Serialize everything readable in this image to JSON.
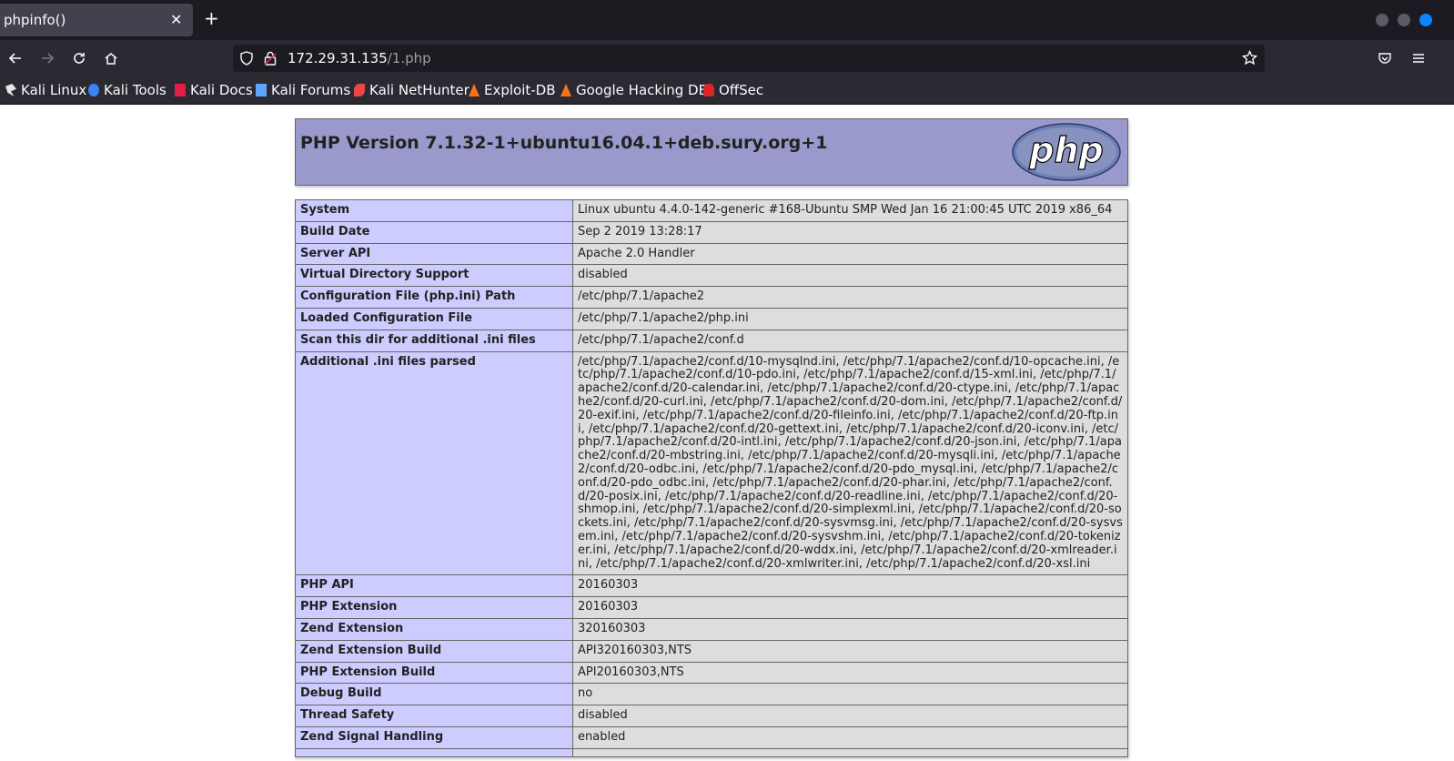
{
  "tab": {
    "title": "phpinfo()"
  },
  "nav": {
    "url_host": "172.29.31.135",
    "url_path": "/1.php"
  },
  "bookmarks": [
    {
      "label": "Kali Linux",
      "icon": "kali-dragon-icon",
      "color": "#e6e6e6"
    },
    {
      "label": "Kali Tools",
      "icon": "kali-tools-icon",
      "color": "#3b82f6"
    },
    {
      "label": "Kali Docs",
      "icon": "kali-docs-icon",
      "color": "#e11d48"
    },
    {
      "label": "Kali Forums",
      "icon": "kali-forums-icon",
      "color": "#60a5fa"
    },
    {
      "label": "Kali NetHunter",
      "icon": "nethunter-icon",
      "color": "#ef4444"
    },
    {
      "label": "Exploit-DB",
      "icon": "exploit-db-icon",
      "color": "#f97316"
    },
    {
      "label": "Google Hacking DB",
      "icon": "ghdb-icon",
      "color": "#f97316"
    },
    {
      "label": "OffSec",
      "icon": "offsec-icon",
      "color": "#dc2626"
    }
  ],
  "page": {
    "title": "PHP Version 7.1.32-1+ubuntu16.04.1+deb.sury.org+1",
    "logo_text": "php",
    "rows": [
      {
        "key": "System",
        "value": "Linux ubuntu 4.4.0-142-generic #168-Ubuntu SMP Wed Jan 16 21:00:45 UTC 2019 x86_64"
      },
      {
        "key": "Build Date",
        "value": "Sep 2 2019 13:28:17"
      },
      {
        "key": "Server API",
        "value": "Apache 2.0 Handler"
      },
      {
        "key": "Virtual Directory Support",
        "value": "disabled"
      },
      {
        "key": "Configuration File (php.ini) Path",
        "value": "/etc/php/7.1/apache2"
      },
      {
        "key": "Loaded Configuration File",
        "value": "/etc/php/7.1/apache2/php.ini"
      },
      {
        "key": "Scan this dir for additional .ini files",
        "value": "/etc/php/7.1/apache2/conf.d"
      },
      {
        "key": "Additional .ini files parsed",
        "value": "/etc/php/7.1/apache2/conf.d/10-mysqlnd.ini, /etc/php/7.1/apache2/conf.d/10-opcache.ini, /etc/php/7.1/apache2/conf.d/10-pdo.ini, /etc/php/7.1/apache2/conf.d/15-xml.ini, /etc/php/7.1/apache2/conf.d/20-calendar.ini, /etc/php/7.1/apache2/conf.d/20-ctype.ini, /etc/php/7.1/apache2/conf.d/20-curl.ini, /etc/php/7.1/apache2/conf.d/20-dom.ini, /etc/php/7.1/apache2/conf.d/20-exif.ini, /etc/php/7.1/apache2/conf.d/20-fileinfo.ini, /etc/php/7.1/apache2/conf.d/20-ftp.ini, /etc/php/7.1/apache2/conf.d/20-gettext.ini, /etc/php/7.1/apache2/conf.d/20-iconv.ini, /etc/php/7.1/apache2/conf.d/20-intl.ini, /etc/php/7.1/apache2/conf.d/20-json.ini, /etc/php/7.1/apache2/conf.d/20-mbstring.ini, /etc/php/7.1/apache2/conf.d/20-mysqli.ini, /etc/php/7.1/apache2/conf.d/20-odbc.ini, /etc/php/7.1/apache2/conf.d/20-pdo_mysql.ini, /etc/php/7.1/apache2/conf.d/20-pdo_odbc.ini, /etc/php/7.1/apache2/conf.d/20-phar.ini, /etc/php/7.1/apache2/conf.d/20-posix.ini, /etc/php/7.1/apache2/conf.d/20-readline.ini, /etc/php/7.1/apache2/conf.d/20-shmop.ini, /etc/php/7.1/apache2/conf.d/20-simplexml.ini, /etc/php/7.1/apache2/conf.d/20-sockets.ini, /etc/php/7.1/apache2/conf.d/20-sysvmsg.ini, /etc/php/7.1/apache2/conf.d/20-sysvsem.ini, /etc/php/7.1/apache2/conf.d/20-sysvshm.ini, /etc/php/7.1/apache2/conf.d/20-tokenizer.ini, /etc/php/7.1/apache2/conf.d/20-wddx.ini, /etc/php/7.1/apache2/conf.d/20-xmlreader.ini, /etc/php/7.1/apache2/conf.d/20-xmlwriter.ini, /etc/php/7.1/apache2/conf.d/20-xsl.ini"
      },
      {
        "key": "PHP API",
        "value": "20160303"
      },
      {
        "key": "PHP Extension",
        "value": "20160303"
      },
      {
        "key": "Zend Extension",
        "value": "320160303"
      },
      {
        "key": "Zend Extension Build",
        "value": "API320160303,NTS"
      },
      {
        "key": "PHP Extension Build",
        "value": "API20160303,NTS"
      },
      {
        "key": "Debug Build",
        "value": "no"
      },
      {
        "key": "Thread Safety",
        "value": "disabled"
      },
      {
        "key": "Zend Signal Handling",
        "value": "enabled"
      },
      {
        "key": "",
        "value": ""
      }
    ]
  }
}
